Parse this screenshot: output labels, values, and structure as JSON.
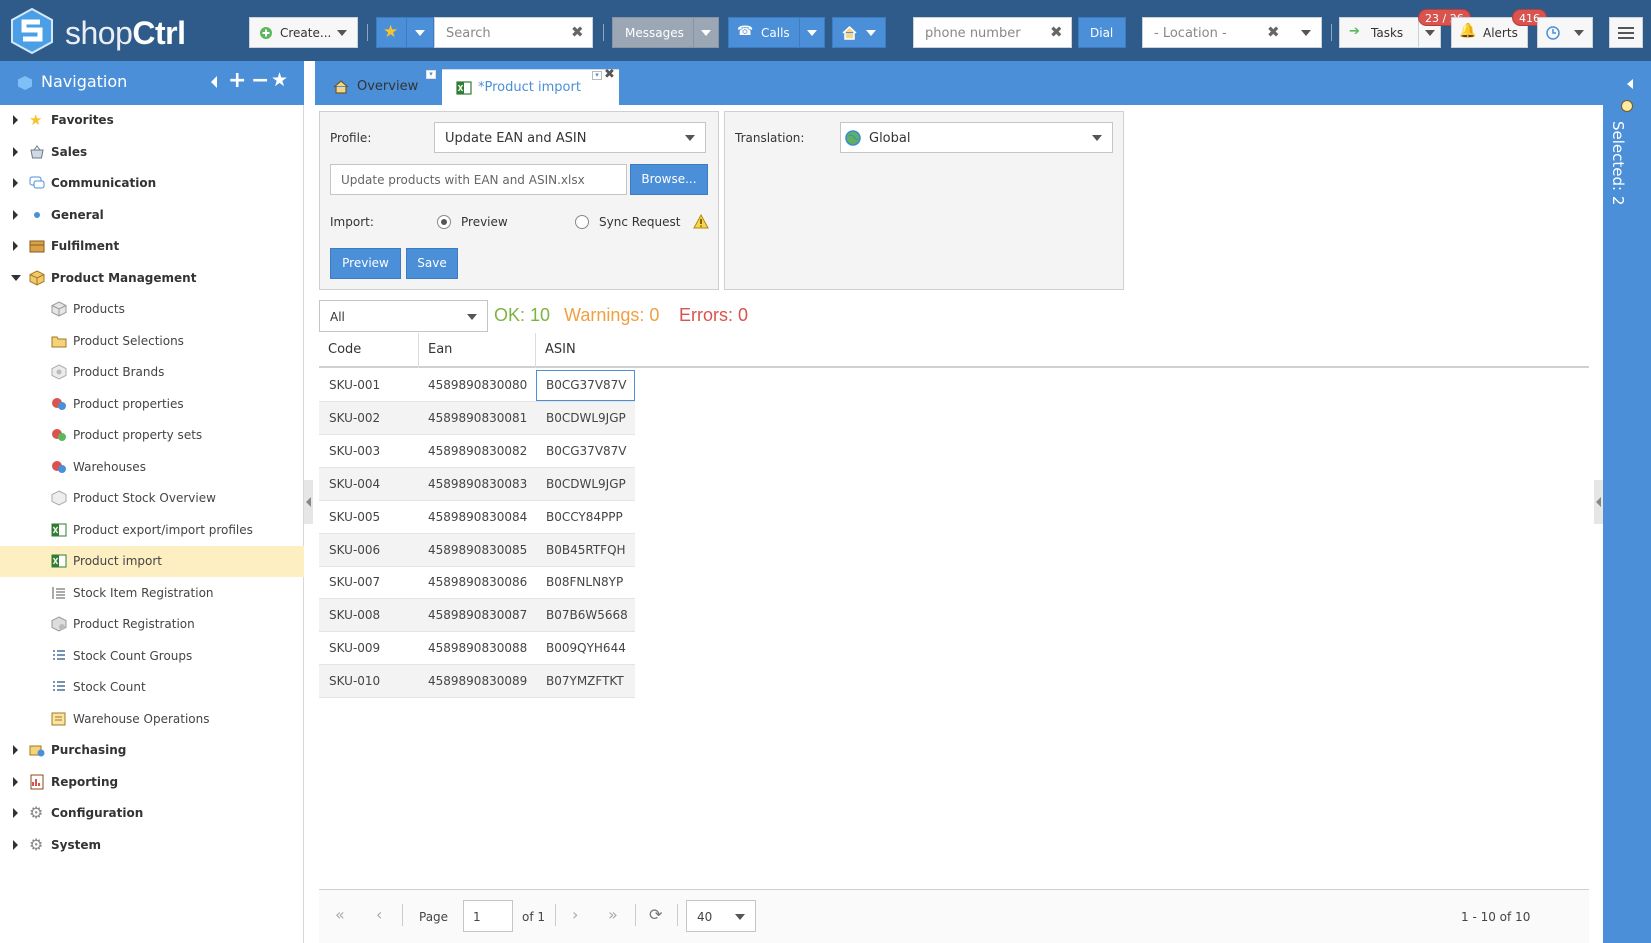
{
  "app": {
    "logo_text_a": "shop",
    "logo_text_b": "Ctrl"
  },
  "topbar": {
    "create_label": "Create...",
    "search_placeholder": "Search",
    "messages_label": "Messages",
    "calls_label": "Calls",
    "phone_placeholder": "phone number",
    "dial_label": "Dial",
    "location_placeholder": "- Location -",
    "tasks_label": "Tasks",
    "tasks_badge": "23 / 26",
    "alerts_label": "Alerts",
    "alerts_badge": "416"
  },
  "nav": {
    "title": "Navigation",
    "items": [
      {
        "label": "Favorites",
        "level": "top",
        "state": "collapsed",
        "icon": "star-icon"
      },
      {
        "label": "Sales",
        "level": "top",
        "state": "collapsed",
        "icon": "basket-icon"
      },
      {
        "label": "Communication",
        "level": "top",
        "state": "collapsed",
        "icon": "chat-icon"
      },
      {
        "label": "General",
        "level": "top",
        "state": "collapsed",
        "icon": "dot-icon"
      },
      {
        "label": "Fulfilment",
        "level": "top",
        "state": "collapsed",
        "icon": "box-icon"
      },
      {
        "label": "Product Management",
        "level": "top",
        "state": "expanded",
        "icon": "package-icon"
      },
      {
        "label": "Products",
        "level": "sub",
        "icon": "cube-icon"
      },
      {
        "label": "Product Selections",
        "level": "sub",
        "icon": "folder-cube-icon"
      },
      {
        "label": "Product Brands",
        "level": "sub",
        "icon": "brand-cube-icon"
      },
      {
        "label": "Product properties",
        "level": "sub",
        "icon": "properties-icon"
      },
      {
        "label": "Product property sets",
        "level": "sub",
        "icon": "property-sets-icon"
      },
      {
        "label": "Warehouses",
        "level": "sub",
        "icon": "warehouse-icon"
      },
      {
        "label": "Product Stock Overview",
        "level": "sub",
        "icon": "stock-overview-icon"
      },
      {
        "label": "Product export/import profiles",
        "level": "sub",
        "icon": "excel-icon"
      },
      {
        "label": "Product import",
        "level": "sub",
        "icon": "excel-icon",
        "active": true
      },
      {
        "label": "Stock Item Registration",
        "level": "sub",
        "icon": "list-icon"
      },
      {
        "label": "Product Registration",
        "level": "sub",
        "icon": "registration-icon"
      },
      {
        "label": "Stock Count Groups",
        "level": "sub",
        "icon": "checklist-icon"
      },
      {
        "label": "Stock Count",
        "level": "sub",
        "icon": "checklist-icon"
      },
      {
        "label": "Warehouse Operations",
        "level": "sub",
        "icon": "operations-icon"
      },
      {
        "label": "Purchasing",
        "level": "top",
        "state": "collapsed",
        "icon": "purchasing-icon"
      },
      {
        "label": "Reporting",
        "level": "top",
        "state": "collapsed",
        "icon": "report-icon"
      },
      {
        "label": "Configuration",
        "level": "top",
        "state": "collapsed",
        "icon": "gear-icon"
      },
      {
        "label": "System",
        "level": "top",
        "state": "collapsed",
        "icon": "gear-icon"
      }
    ]
  },
  "tabs": [
    {
      "label": "Overview",
      "icon": "home-icon"
    },
    {
      "label": "*Product import",
      "icon": "excel-icon"
    }
  ],
  "import_form": {
    "profile_label": "Profile:",
    "profile_value": "Update EAN and ASIN",
    "file_value": "Update products with EAN and ASIN.xlsx",
    "browse_label": "Browse...",
    "import_label": "Import:",
    "option_preview": "Preview",
    "option_sync": "Sync Request",
    "preview_button": "Preview",
    "save_button": "Save",
    "translation_label": "Translation:",
    "translation_value": "Global"
  },
  "results": {
    "filter_value": "All",
    "ok": "OK: 10",
    "warnings": "Warnings: 0",
    "errors": "Errors: 0",
    "ok_color": "#7cb342",
    "warn_color": "#f0a040",
    "err_color": "#d9534f"
  },
  "table": {
    "columns": [
      "Code",
      "Ean",
      "ASIN"
    ],
    "rows": [
      [
        "SKU-001",
        "4589890830080",
        "B0CG37V87V"
      ],
      [
        "SKU-002",
        "4589890830081",
        "B0CDWL9JGP"
      ],
      [
        "SKU-003",
        "4589890830082",
        "B0CG37V87V"
      ],
      [
        "SKU-004",
        "4589890830083",
        "B0CDWL9JGP"
      ],
      [
        "SKU-005",
        "4589890830084",
        "B0CCY84PPP"
      ],
      [
        "SKU-006",
        "4589890830085",
        "B0B45RTFQH"
      ],
      [
        "SKU-007",
        "4589890830086",
        "B08FNLN8YP"
      ],
      [
        "SKU-008",
        "4589890830087",
        "B07B6W5668"
      ],
      [
        "SKU-009",
        "4589890830088",
        "B009QYH644"
      ],
      [
        "SKU-010",
        "4589890830089",
        "B07YMZFTKT"
      ]
    ]
  },
  "pager": {
    "page_label": "Page",
    "page_value": "1",
    "of_label": "of 1",
    "page_size": "40",
    "summary": "1 - 10 of 10"
  },
  "right_strip": {
    "selected_label": "Selected: 2"
  },
  "colors": {
    "topbar": "#2e5b8a",
    "accent": "#4a8fd8",
    "active_nav": "#fdefc2"
  }
}
